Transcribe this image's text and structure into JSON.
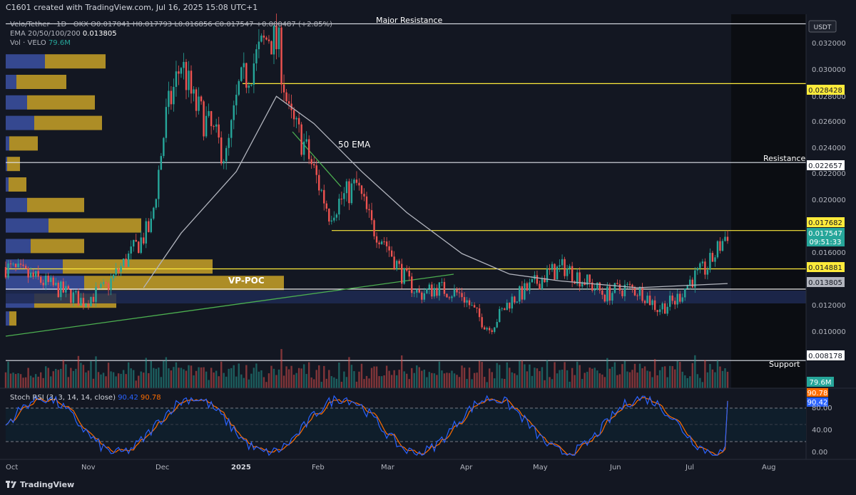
{
  "header": {
    "text": "C1601 created with TradingView.com, Jul 16, 2025 15:08 UTC+1"
  },
  "legend": {
    "symbol": "Velo/Tether · 1D · OKX",
    "ohlc": "O0.017041 H0.017793 L0.016856 C0.017547 +0.000487 (+2.85%)",
    "ema_label": "EMA 20/50/100/200",
    "ema_value": "0.013805",
    "vol_label": "Vol · VELO",
    "vol_value": "79.6M"
  },
  "price_scale": {
    "currency": "USDT",
    "ticks": [
      "0.032000",
      "0.030000",
      "0.028000",
      "0.026000",
      "0.024000",
      "0.022000",
      "0.020000",
      "0.016000",
      "0.012000",
      "0.010000"
    ]
  },
  "time_axis": {
    "labels": [
      "Oct",
      "Nov",
      "Dec",
      "2025",
      "Feb",
      "Mar",
      "Apr",
      "May",
      "Jun",
      "Jul",
      "Aug"
    ]
  },
  "badges": {
    "major_resistance": "0.028428",
    "resistance": "0.022657",
    "upper": "0.017682",
    "last": "0.017547",
    "countdown": "09:51:33",
    "mid": "0.014881",
    "ema": "0.013805",
    "support": "0.008178",
    "volume": "79.6M",
    "stoch_d": "90.78",
    "stoch_k": "90.42"
  },
  "annotations": {
    "major_resistance": "Major Resistance",
    "resistance": "Resistance",
    "support": "Support",
    "ema": "50 EMA",
    "vp_poc": "VP-POC"
  },
  "stoch": {
    "title": "Stoch RSI (3, 3, 14, 14, close)",
    "k_value": "90.42",
    "d_value": "90.78",
    "ticks": [
      "80.00",
      "40.00",
      "0.00"
    ]
  },
  "footer": {
    "brand": "TradingView"
  },
  "colors": {
    "bg": "#131722",
    "up": "#26a69a",
    "down": "#ef5350",
    "yellow": "#ffeb3b",
    "white_line": "#e0e3eb",
    "ema": "#b2b5be",
    "trend": "#4caf50",
    "stoch_k": "#2962ff",
    "stoch_d": "#ff6d00",
    "vp_gold": "#c9a227",
    "vp_blue": "#3a4e9c"
  },
  "chart_data": {
    "type": "candlestick",
    "symbol": "Velo/Tether",
    "timeframe": "1D",
    "ylim": [
      0.0085,
      0.0335
    ],
    "x": [
      "2024-10",
      "2024-11",
      "2024-12",
      "2025-01",
      "2025-02",
      "2025-03",
      "2025-04",
      "2025-05",
      "2025-06",
      "2025-07",
      "2025-08"
    ],
    "close_path": [
      [
        "2024-10-01",
        0.015
      ],
      [
        "2024-10-15",
        0.014
      ],
      [
        "2024-11-01",
        0.0125
      ],
      [
        "2024-11-10",
        0.0135
      ],
      [
        "2024-11-20",
        0.016
      ],
      [
        "2024-11-28",
        0.018
      ],
      [
        "2024-12-04",
        0.026
      ],
      [
        "2024-12-10",
        0.03
      ],
      [
        "2024-12-15",
        0.027
      ],
      [
        "2024-12-22",
        0.025
      ],
      [
        "2024-12-28",
        0.023
      ],
      [
        "2025-01-02",
        0.028
      ],
      [
        "2025-01-08",
        0.03
      ],
      [
        "2025-01-14",
        0.032
      ],
      [
        "2025-01-18",
        0.031
      ],
      [
        "2025-01-22",
        0.026
      ],
      [
        "2025-01-28",
        0.024
      ],
      [
        "2025-02-03",
        0.021
      ],
      [
        "2025-02-07",
        0.019
      ],
      [
        "2025-02-12",
        0.02
      ],
      [
        "2025-02-18",
        0.021
      ],
      [
        "2025-02-24",
        0.018
      ],
      [
        "2025-03-01",
        0.017
      ],
      [
        "2025-03-08",
        0.0145
      ],
      [
        "2025-03-15",
        0.013
      ],
      [
        "2025-03-22",
        0.0135
      ],
      [
        "2025-04-01",
        0.013
      ],
      [
        "2025-04-07",
        0.0115
      ],
      [
        "2025-04-12",
        0.0105
      ],
      [
        "2025-04-20",
        0.0125
      ],
      [
        "2025-04-28",
        0.0135
      ],
      [
        "2025-05-05",
        0.0145
      ],
      [
        "2025-05-12",
        0.015
      ],
      [
        "2025-05-20",
        0.014
      ],
      [
        "2025-05-28",
        0.013
      ],
      [
        "2025-06-05",
        0.0135
      ],
      [
        "2025-06-12",
        0.0132
      ],
      [
        "2025-06-18",
        0.012
      ],
      [
        "2025-06-25",
        0.0125
      ],
      [
        "2025-07-01",
        0.014
      ],
      [
        "2025-07-08",
        0.015
      ],
      [
        "2025-07-16",
        0.017547
      ]
    ],
    "ema50_path": [
      [
        "2024-11-25",
        0.0135
      ],
      [
        "2024-12-10",
        0.0175
      ],
      [
        "2025-01-01",
        0.022
      ],
      [
        "2025-01-17",
        0.0275
      ],
      [
        "2025-02-01",
        0.0255
      ],
      [
        "2025-02-20",
        0.022
      ],
      [
        "2025-03-10",
        0.019
      ],
      [
        "2025-04-01",
        0.016
      ],
      [
        "2025-04-20",
        0.0145
      ],
      [
        "2025-05-10",
        0.014
      ],
      [
        "2025-06-10",
        0.0135
      ],
      [
        "2025-07-16",
        0.013805
      ]
    ],
    "levels": [
      {
        "label": "Major Resistance",
        "value": 0.0328
      },
      {
        "value": 0.028428
      },
      {
        "label": "Resistance",
        "value": 0.022657
      },
      {
        "value": 0.017682
      },
      {
        "value": 0.014881
      },
      {
        "label": "VP-POC",
        "value": 0.0134
      },
      {
        "label": "Support",
        "value": 0.008178
      }
    ],
    "stoch_rsi": {
      "k_last": 90.42,
      "d_last": 90.78,
      "ylim": [
        0,
        100
      ]
    },
    "volume_last": "79.6M"
  }
}
